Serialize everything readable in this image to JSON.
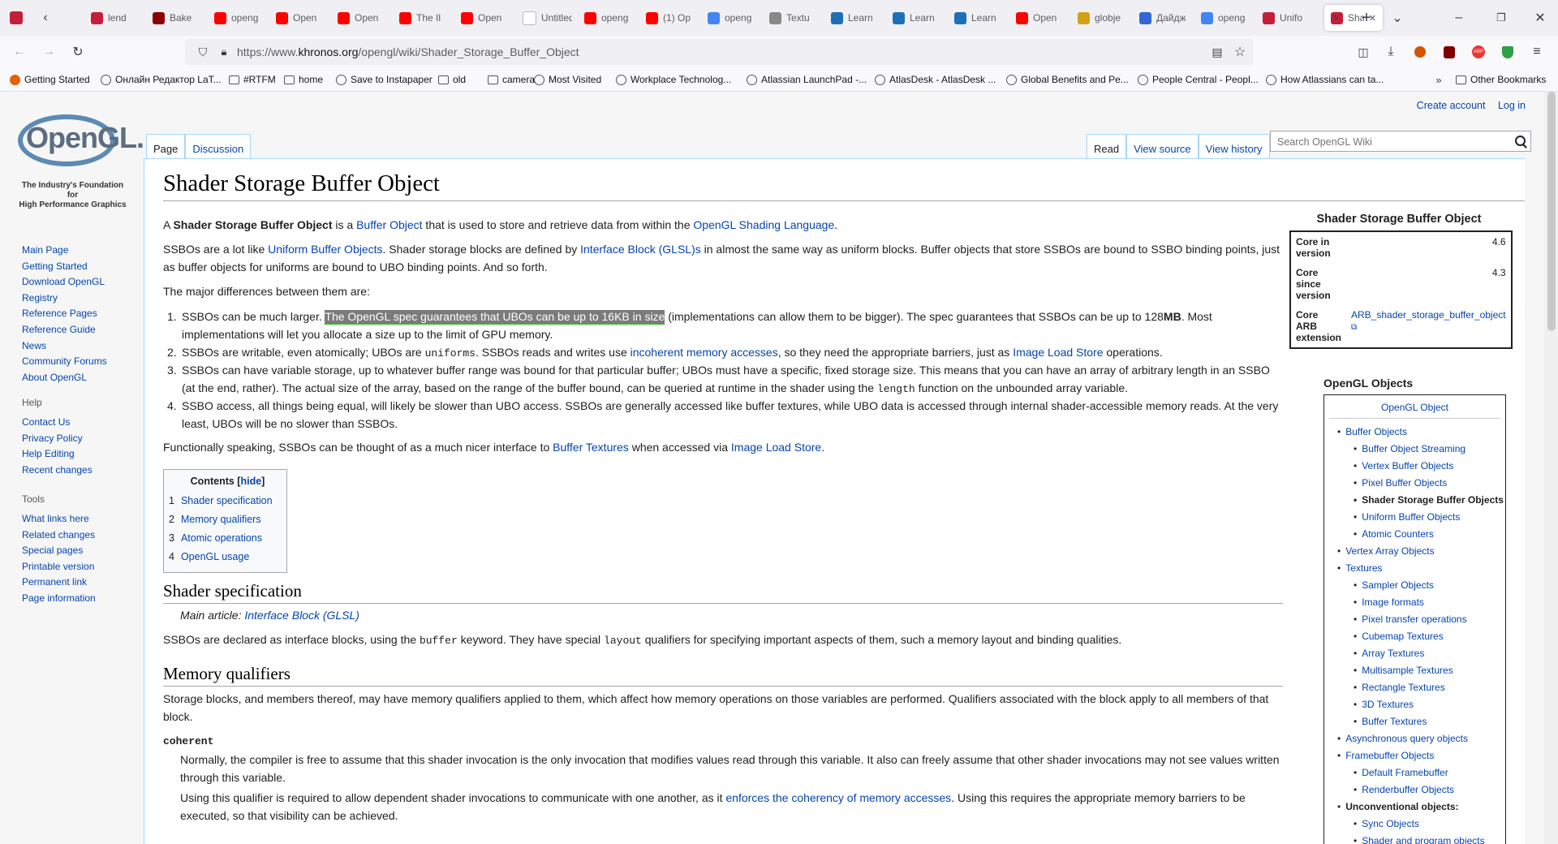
{
  "tabs": [
    {
      "title": "lend",
      "icon": "firefox-view-icon",
      "color": "#c41e3a"
    },
    {
      "title": "Bake",
      "icon": "red-square-icon",
      "color": "#8b0000"
    },
    {
      "title": "openg",
      "icon": "youtube-icon",
      "color": "#ff0000"
    },
    {
      "title": "Open",
      "icon": "youtube-icon",
      "color": "#ff0000"
    },
    {
      "title": "Open",
      "icon": "youtube-icon",
      "color": "#ff0000"
    },
    {
      "title": "The Il",
      "icon": "youtube-icon",
      "color": "#ff0000"
    },
    {
      "title": "Open",
      "icon": "youtube-icon",
      "color": "#ff0000"
    },
    {
      "title": "Untitled -",
      "icon": "blank-icon",
      "color": "#ffffff"
    },
    {
      "title": "openg",
      "icon": "youtube-icon",
      "color": "#ff0000"
    },
    {
      "title": "(1) Op",
      "icon": "youtube-icon",
      "color": "#ff0000"
    },
    {
      "title": "openg",
      "icon": "google-icon",
      "color": "#4285f4"
    },
    {
      "title": "Textu",
      "icon": "texture-icon",
      "color": "#888888"
    },
    {
      "title": "Learn",
      "icon": "learn-icon",
      "color": "#1e6fb5"
    },
    {
      "title": "Learn",
      "icon": "learn-icon",
      "color": "#1e6fb5"
    },
    {
      "title": "Learn",
      "icon": "learn-icon",
      "color": "#1e6fb5"
    },
    {
      "title": "Open",
      "icon": "youtube-icon",
      "color": "#ff0000"
    },
    {
      "title": "globje",
      "icon": "gloss-icon",
      "color": "#d4a017"
    },
    {
      "title": "Дайдж",
      "icon": "tracker-icon",
      "color": "#3367d6"
    },
    {
      "title": "openg",
      "icon": "google-icon",
      "color": "#4285f4"
    },
    {
      "title": "Unifo",
      "icon": "opengl-icon",
      "color": "#c41e3a"
    },
    {
      "title": "Sha",
      "icon": "opengl-icon",
      "color": "#c41e3a"
    }
  ],
  "url": {
    "prefix": "https://www.",
    "host": "khronos.org",
    "path": "/opengl/wiki/Shader_Storage_Buffer_Object"
  },
  "bookmarks": [
    "Getting Started",
    "Онлайн Редактор LaT...",
    "#RTFM",
    "home",
    "Save to Instapaper",
    "old",
    "camera",
    "Most Visited",
    "Workplace Technolog...",
    "Atlassian LaunchPad -...",
    "AtlasDesk - AtlasDesk ...",
    "Global Benefits and Pe...",
    "People Central - Peopl...",
    "How Atlassians can ta...",
    "Other Bookmarks"
  ],
  "personal": {
    "create": "Create account",
    "login": "Log in"
  },
  "logo": {
    "word": "OpenGL",
    "tagline1": "The Industry's Foundation for",
    "tagline2": "High Performance Graphics"
  },
  "nav_main": [
    "Main Page",
    "Getting Started",
    "Download OpenGL",
    "Registry",
    "Reference Pages",
    "Reference Guide",
    "News",
    "Community Forums",
    "About OpenGL"
  ],
  "nav_help": {
    "title": "Help",
    "items": [
      "Contact Us",
      "Privacy Policy",
      "Help Editing",
      "Recent changes"
    ]
  },
  "nav_tools": {
    "title": "Tools",
    "items": [
      "What links here",
      "Related changes",
      "Special pages",
      "Printable version",
      "Permanent link",
      "Page information"
    ]
  },
  "wiki_tabs": {
    "page": "Page",
    "discussion": "Discussion",
    "read": "Read",
    "view_source": "View source",
    "view_history": "View history"
  },
  "search": {
    "placeholder": "Search OpenGL Wiki"
  },
  "article": {
    "title": "Shader Storage Buffer Object",
    "p1": {
      "a": "A ",
      "b": "Shader Storage Buffer Object",
      "c": " is a ",
      "l1": "Buffer Object",
      "d": " that is used to store and retrieve data from within the ",
      "l2": "OpenGL Shading Language",
      "e": "."
    },
    "p2": {
      "a": "SSBOs are a lot like ",
      "l1": "Uniform Buffer Objects",
      "b": ". Shader storage blocks are defined by ",
      "l2": "Interface Block (GLSL)s",
      "c": " in almost the same way as uniform blocks. Buffer objects that store SSBOs are bound to SSBO binding points, just as buffer objects for uniforms are bound to UBO binding points. And so forth."
    },
    "p3": "The major differences between them are:",
    "li1": {
      "a": "SSBOs can be much larger. ",
      "hl": "The OpenGL spec guarantees that UBOs can be up to 16KB in size",
      "b": " (implementations can allow them to be bigger). The spec guarantees that SSBOs can be up to 128",
      "mb": "MB",
      "c": ". Most implementations will let you allocate a size up to the limit of GPU memory."
    },
    "li2": {
      "a": "SSBOs are writable, even atomically; UBOs are ",
      "code": "uniforms",
      "b": ". SSBOs reads and writes use ",
      "l1": "incoherent memory accesses",
      "c": ", so they need the appropriate barriers, just as ",
      "l2": "Image Load Store",
      "d": " operations."
    },
    "li3": {
      "a": "SSBOs can have variable storage, up to whatever buffer range was bound for that particular buffer; UBOs must have a specific, fixed storage size. This means that you can have an array of arbitrary length in an SSBO (at the end, rather). The actual size of the array, based on the range of the buffer bound, can be queried at runtime in the shader using the ",
      "code": "length",
      "b": " function on the unbounded array variable."
    },
    "li4": "SSBO access, all things being equal, will likely be slower than UBO access. SSBOs are generally accessed like buffer textures, while UBO data is accessed through internal shader-accessible memory reads. At the very least, UBOs will be no slower than SSBOs.",
    "p4": {
      "a": "Functionally speaking, SSBOs can be thought of as a much nicer interface to ",
      "l1": "Buffer Textures",
      "b": " when accessed via ",
      "l2": "Image Load Store",
      "c": "."
    },
    "toc": {
      "title": "Contents",
      "hide": "hide",
      "items": [
        {
          "n": "1",
          "t": "Shader specification"
        },
        {
          "n": "2",
          "t": "Memory qualifiers"
        },
        {
          "n": "3",
          "t": "Atomic operations"
        },
        {
          "n": "4",
          "t": "OpenGL usage"
        }
      ]
    },
    "h2_1": "Shader specification",
    "main_article": {
      "a": "Main article: ",
      "l": "Interface Block (GLSL)"
    },
    "p5": {
      "a": "SSBOs are declared as interface blocks, using the ",
      "c1": "buffer",
      "b": " keyword. They have special ",
      "c2": "layout",
      "c": " qualifiers for specifying important aspects of them, such a memory layout and binding qualities."
    },
    "h2_2": "Memory qualifiers",
    "p6": "Storage blocks, and members thereof, may have memory qualifiers applied to them, which affect how memory operations on those variables are performed. Qualifiers associated with the block apply to all members of that block.",
    "coherent": "coherent",
    "p7": "Normally, the compiler is free to assume that this shader invocation is the only invocation that modifies values read through this variable. It also can freely assume that other shader invocations may not see values written through this variable.",
    "p8": {
      "a": "Using this qualifier is required to allow dependent shader invocations to communicate with one another, as it ",
      "l": "enforces the coherency of memory accesses",
      "b": ". Using this requires the appropriate memory barriers to be executed, so that visibility can be achieved."
    }
  },
  "infobox": {
    "title": "Shader Storage Buffer Object",
    "rows": [
      {
        "k": "Core in version",
        "v": "4.6"
      },
      {
        "k": "Core since version",
        "v": "4.3"
      },
      {
        "k": "Core ARB extension",
        "v": "ARB_shader_storage_buffer_object"
      }
    ]
  },
  "navbox": {
    "title": "OpenGL Objects",
    "header": "OpenGL Object",
    "items": [
      {
        "t": "Buffer Objects",
        "lvl": 1
      },
      {
        "t": "Buffer Object Streaming",
        "lvl": 2
      },
      {
        "t": "Vertex Buffer Objects",
        "lvl": 2
      },
      {
        "t": "Pixel Buffer Objects",
        "lvl": 2
      },
      {
        "t": "Shader Storage Buffer Objects",
        "lvl": 2,
        "cur": true
      },
      {
        "t": "Uniform Buffer Objects",
        "lvl": 2
      },
      {
        "t": "Atomic Counters",
        "lvl": 2
      },
      {
        "t": "Vertex Array Objects",
        "lvl": 1
      },
      {
        "t": "Textures",
        "lvl": 1
      },
      {
        "t": "Sampler Objects",
        "lvl": 2
      },
      {
        "t": "Image formats",
        "lvl": 2
      },
      {
        "t": "Pixel transfer operations",
        "lvl": 2
      },
      {
        "t": "Cubemap Textures",
        "lvl": 2
      },
      {
        "t": "Array Textures",
        "lvl": 2
      },
      {
        "t": "Multisample Textures",
        "lvl": 2
      },
      {
        "t": "Rectangle Textures",
        "lvl": 2
      },
      {
        "t": "3D Textures",
        "lvl": 2
      },
      {
        "t": "Buffer Textures",
        "lvl": 2
      },
      {
        "t": "Asynchronous query objects",
        "lvl": 1
      },
      {
        "t": "Framebuffer Objects",
        "lvl": 1
      },
      {
        "t": "Default Framebuffer",
        "lvl": 2
      },
      {
        "t": "Renderbuffer Objects",
        "lvl": 2
      },
      {
        "t": "Unconventional objects:",
        "lvl": 1,
        "bold": true
      },
      {
        "t": "Sync Objects",
        "lvl": 2
      },
      {
        "t": "Shader and program objects",
        "lvl": 2
      }
    ]
  },
  "colors": {
    "link": "#0645ad",
    "highlight": "#7b7b7b",
    "underline": "#2ebd1a",
    "border": "#a7d7f9"
  }
}
